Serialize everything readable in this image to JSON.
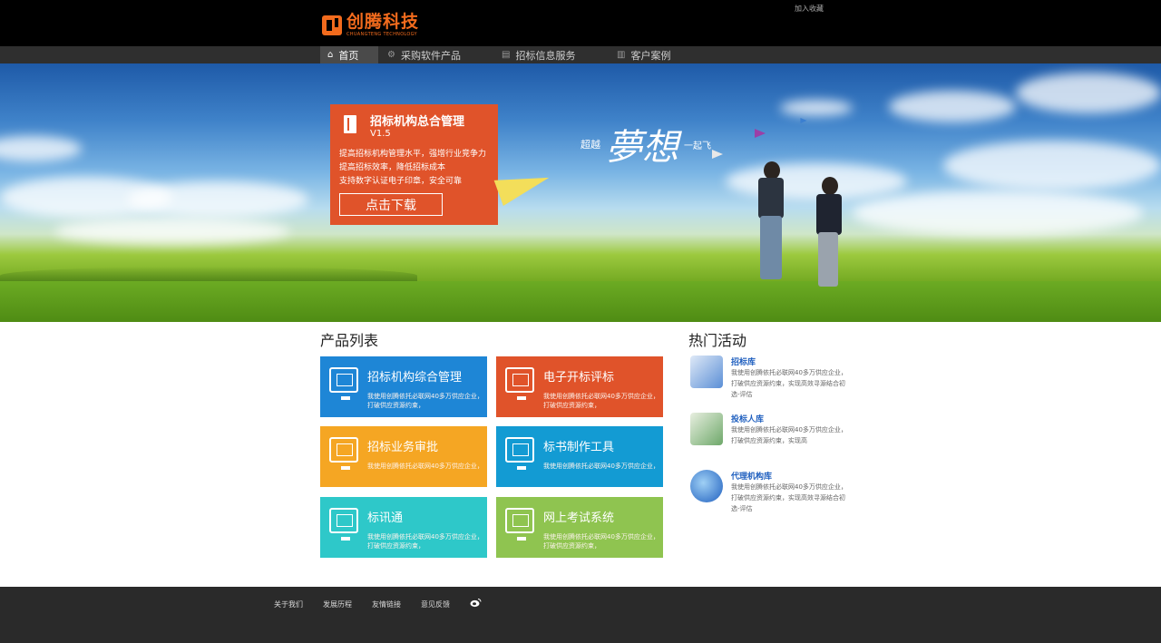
{
  "header": {
    "logo_cn": "创腾科技",
    "logo_en": "CHUANGTENG TECHNOLOGY",
    "favorite_link": "加入收藏",
    "brand_color": "#f26b1d"
  },
  "nav": {
    "items": [
      {
        "label": "首页",
        "icon": "home-icon",
        "active": true
      },
      {
        "label": "采购软件产品",
        "icon": "gear-icon",
        "active": false
      },
      {
        "label": "招标信息服务",
        "icon": "document-icon",
        "active": false
      },
      {
        "label": "客户案例",
        "icon": "clipboard-icon",
        "active": false
      }
    ]
  },
  "banner": {
    "promo_title": "招标机构总合管理",
    "promo_version": "V1.5",
    "promo_lines": [
      "提高招标机构管理水平，强增行业竞争力",
      "提高招标效率，降低招标成本",
      "支持数字认证电子印章，安全可靠"
    ],
    "download_button": "点击下载",
    "slogan_prefix": "超越",
    "slogan_main": "夢想",
    "slogan_suffix": "一起飞",
    "promo_color": "#e0532a"
  },
  "products": {
    "title": "产品列表",
    "items": [
      {
        "title": "招标机构综合管理",
        "desc": "我使用创腾依托必联网40多万供应企业，打破供应资源约束，",
        "color": "#1e86d6"
      },
      {
        "title": "电子开标评标",
        "desc": "我使用创腾依托必联网40多万供应企业，打破供应资源约束，",
        "color": "#e0532a"
      },
      {
        "title": "招标业务审批",
        "desc": "我使用创腾依托必联网40多万供应企业，",
        "color": "#f5a623"
      },
      {
        "title": "标书制作工具",
        "desc": "我使用创腾依托必联网40多万供应企业，",
        "color": "#139bd3"
      },
      {
        "title": "标讯通",
        "desc": "我使用创腾依托必联网40多万供应企业，打破供应资源约束，",
        "color": "#2ec8c9"
      },
      {
        "title": "网上考试系统",
        "desc": "我使用创腾依托必联网40多万供应企业，打破供应资源约束，",
        "color": "#8fc450"
      }
    ]
  },
  "hot": {
    "title": "热门活动",
    "items": [
      {
        "title": "招标库",
        "desc": "我使用创腾依托必联网40多万供应企业，打破供应资源约束，实现高效寻源结合初选-评估",
        "icon": "magnifier-icon"
      },
      {
        "title": "投标人库",
        "desc": "我使用创腾依托必联网40多万供应企业，打破供应资源约束，实现高",
        "icon": "id-card-icon"
      },
      {
        "title": "代理机构库",
        "desc": "我使用创腾依托必联网40多万供应企业，打破供应资源约束，实现高效寻源结合初选-评估",
        "icon": "globe-icon"
      }
    ]
  },
  "footer": {
    "links": [
      "关于我们",
      "发展历程",
      "友情链接",
      "意见反馈"
    ],
    "social_icon": "weibo-icon"
  }
}
